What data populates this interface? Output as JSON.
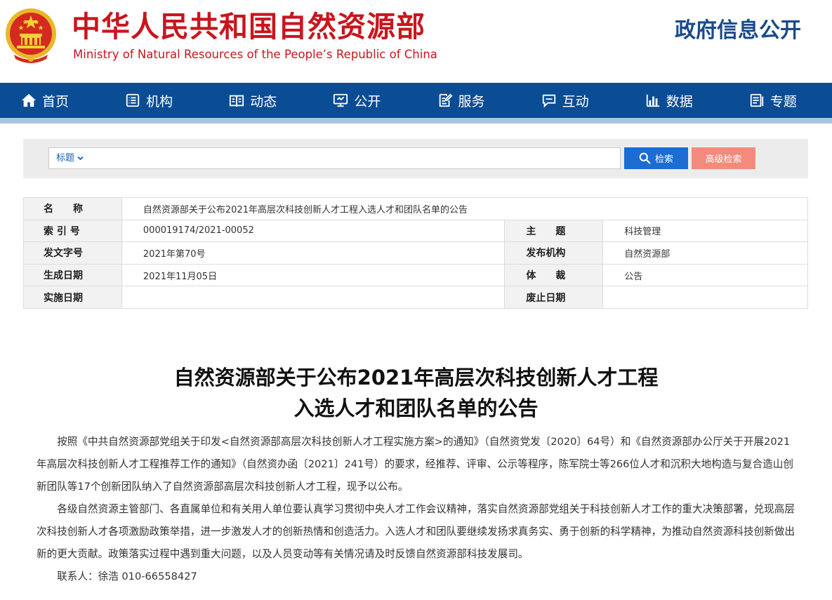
{
  "header": {
    "title_cn": "中华人民共和国自然资源部",
    "title_en": "Ministry of Natural Resources of the People’s Republic of China",
    "gov_info": "政府信息公开"
  },
  "nav": {
    "items": [
      {
        "label": "首页",
        "icon": "home-icon"
      },
      {
        "label": "机构",
        "icon": "org-icon"
      },
      {
        "label": "动态",
        "icon": "book-icon"
      },
      {
        "label": "公开",
        "icon": "monitor-icon"
      },
      {
        "label": "服务",
        "icon": "edit-doc-icon"
      },
      {
        "label": "互动",
        "icon": "chat-icon"
      },
      {
        "label": "数据",
        "icon": "bar-chart-icon"
      },
      {
        "label": "专题",
        "icon": "topic-icon"
      }
    ]
  },
  "search": {
    "field_label": "标题",
    "query": "",
    "search_label": "检索",
    "advanced_label": "高级检索"
  },
  "info": {
    "name_label": "名　　称",
    "name_value": "自然资源部关于公布2021年高层次科技创新人才工程入选人才和团队名单的公告",
    "index_label": "索 引 号",
    "index_value": "000019174/2021-00052",
    "topic_label": "主　　题",
    "topic_value": "科技管理",
    "doc_no_label": "发文字号",
    "doc_no_value": "2021年第70号",
    "issuer_label": "发布机构",
    "issuer_value": "自然资源部",
    "date_label": "生成日期",
    "date_value": "2021年11月05日",
    "genre_label": "体　　裁",
    "genre_value": "公告",
    "effective_label": "实施日期",
    "effective_value": "",
    "expiry_label": "废止日期",
    "expiry_value": ""
  },
  "article": {
    "title_line1": "自然资源部关于公布2021年高层次科技创新人才工程",
    "title_line2": "入选人才和团队名单的公告",
    "paragraph1": "按照《中共自然资源部党组关于印发<自然资源部高层次科技创新人才工程实施方案>的通知》（自然资党发〔2020〕64号）和《自然资源部办公厅关于开展2021年高层次科技创新人才工程推荐工作的通知》（自然资办函〔2021〕241号）的要求，经推荐、评审、公示等程序，陈军院士等266位人才和沉积大地构造与复合造山创新团队等17个创新团队纳入了自然资源部高层次科技创新人才工程，现予以公布。",
    "paragraph2": "各级自然资源主管部门、各直属单位和有关用人单位要认真学习贯彻中央人才工作会议精神，落实自然资源部党组关于科技创新人才工作的重大决策部署，兑现高层次科技创新人才各项激励政策举措，进一步激发人才的创新热情和创造活力。入选人才和团队要继续发扬求真务实、勇于创新的科学精神，为推动自然资源科技创新做出新的更大贡献。政策落实过程中遇到重大问题，以及人员变动等有关情况请及时反馈自然资源部科技发展司。",
    "contact": "联系人：徐浩 010-66558427"
  },
  "colors": {
    "brand_red": "#c8161d",
    "nav_blue": "#0b4d95",
    "search_blue": "#1c6cd3",
    "advanced_salmon": "#f28b7b"
  }
}
